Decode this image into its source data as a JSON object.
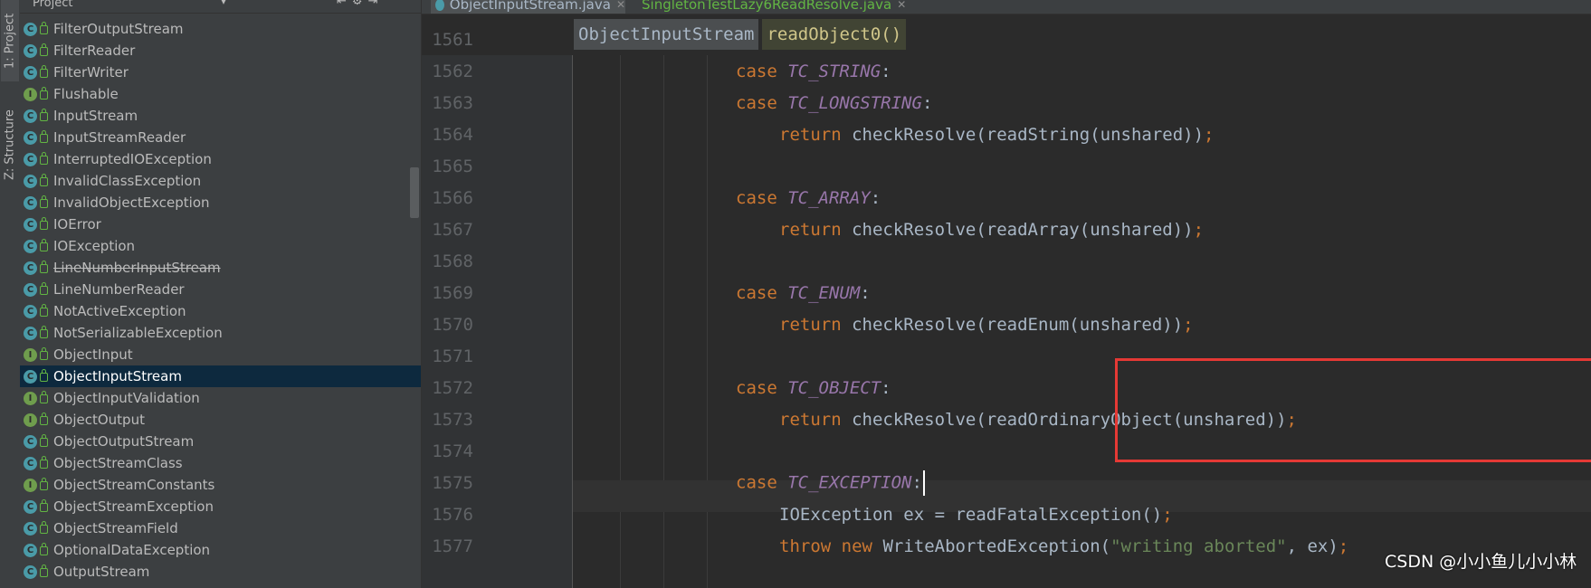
{
  "tool_strip": {
    "project_tab": "1: Project",
    "structure_tab": "Z: Structure"
  },
  "project_panel": {
    "title": "Project",
    "items": [
      {
        "label": "FilterOutputStream",
        "kind": "C"
      },
      {
        "label": "FilterReader",
        "kind": "C"
      },
      {
        "label": "FilterWriter",
        "kind": "C"
      },
      {
        "label": "Flushable",
        "kind": "I"
      },
      {
        "label": "InputStream",
        "kind": "C"
      },
      {
        "label": "InputStreamReader",
        "kind": "C"
      },
      {
        "label": "InterruptedIOException",
        "kind": "C"
      },
      {
        "label": "InvalidClassException",
        "kind": "C"
      },
      {
        "label": "InvalidObjectException",
        "kind": "C"
      },
      {
        "label": "IOError",
        "kind": "C"
      },
      {
        "label": "IOException",
        "kind": "C"
      },
      {
        "label": "LineNumberInputStream",
        "kind": "C"
      },
      {
        "label": "LineNumberReader",
        "kind": "C"
      },
      {
        "label": "NotActiveException",
        "kind": "C"
      },
      {
        "label": "NotSerializableException",
        "kind": "C"
      },
      {
        "label": "ObjectInput",
        "kind": "I"
      },
      {
        "label": "ObjectInputStream",
        "kind": "C"
      },
      {
        "label": "ObjectInputValidation",
        "kind": "I"
      },
      {
        "label": "ObjectOutput",
        "kind": "I"
      },
      {
        "label": "ObjectOutputStream",
        "kind": "C"
      },
      {
        "label": "ObjectStreamClass",
        "kind": "C"
      },
      {
        "label": "ObjectStreamConstants",
        "kind": "I"
      },
      {
        "label": "ObjectStreamException",
        "kind": "C"
      },
      {
        "label": "ObjectStreamField",
        "kind": "C"
      },
      {
        "label": "OptionalDataException",
        "kind": "C"
      },
      {
        "label": "OutputStream",
        "kind": "C"
      }
    ]
  },
  "editor": {
    "tabs": [
      {
        "label": "ObjectInputStream.java"
      },
      {
        "label": "SingletonTestLazy6ReadResolve.java"
      }
    ],
    "breadcrumb": [
      "ObjectInputStream",
      "readObject0()"
    ],
    "partial_line_number": "1561",
    "lines": [
      {
        "num": "1562",
        "kw": "case",
        "const": "TC_STRING",
        "rest": ":"
      },
      {
        "num": "1563",
        "kw": "case",
        "const": "TC_LONGSTRING",
        "rest": ":"
      },
      {
        "num": "1564",
        "kw": "return",
        "rest": "checkResolve(readString(unshared))",
        "semi": ";"
      },
      {
        "num": "1565"
      },
      {
        "num": "1566",
        "kw": "case",
        "const": "TC_ARRAY",
        "rest": ":"
      },
      {
        "num": "1567",
        "kw": "return",
        "rest": "checkResolve(readArray(unshared))",
        "semi": ";"
      },
      {
        "num": "1568"
      },
      {
        "num": "1569",
        "kw": "case",
        "const": "TC_ENUM",
        "rest": ":"
      },
      {
        "num": "1570",
        "kw": "return",
        "rest": "checkResolve(readEnum(unshared))",
        "semi": ";"
      },
      {
        "num": "1571"
      },
      {
        "num": "1572",
        "kw": "case",
        "const": "TC_OBJECT",
        "rest": ":"
      },
      {
        "num": "1573",
        "kw": "return",
        "rest": "checkResolve(readOrdinaryObject(unshared))",
        "semi": ";"
      },
      {
        "num": "1574"
      },
      {
        "num": "1575",
        "kw": "case",
        "const": "TC_EXCEPTION",
        "rest": ":"
      },
      {
        "num": "1576",
        "code_a": "IOException ex = readFatalException()",
        "semi": ";"
      },
      {
        "num": "1577",
        "kw": "throw",
        "kw2": "new",
        "code_a": "WriteAbortedException(",
        "str": "\"writing aborted\"",
        "code_b": ", ex)",
        "semi": ";"
      }
    ]
  },
  "watermark": "CSDN @小小鱼儿小小林",
  "colors": {
    "keyword": "#cc7832",
    "constant": "#9876aa",
    "string": "#6a8759",
    "highlight_box": "#e53935"
  }
}
